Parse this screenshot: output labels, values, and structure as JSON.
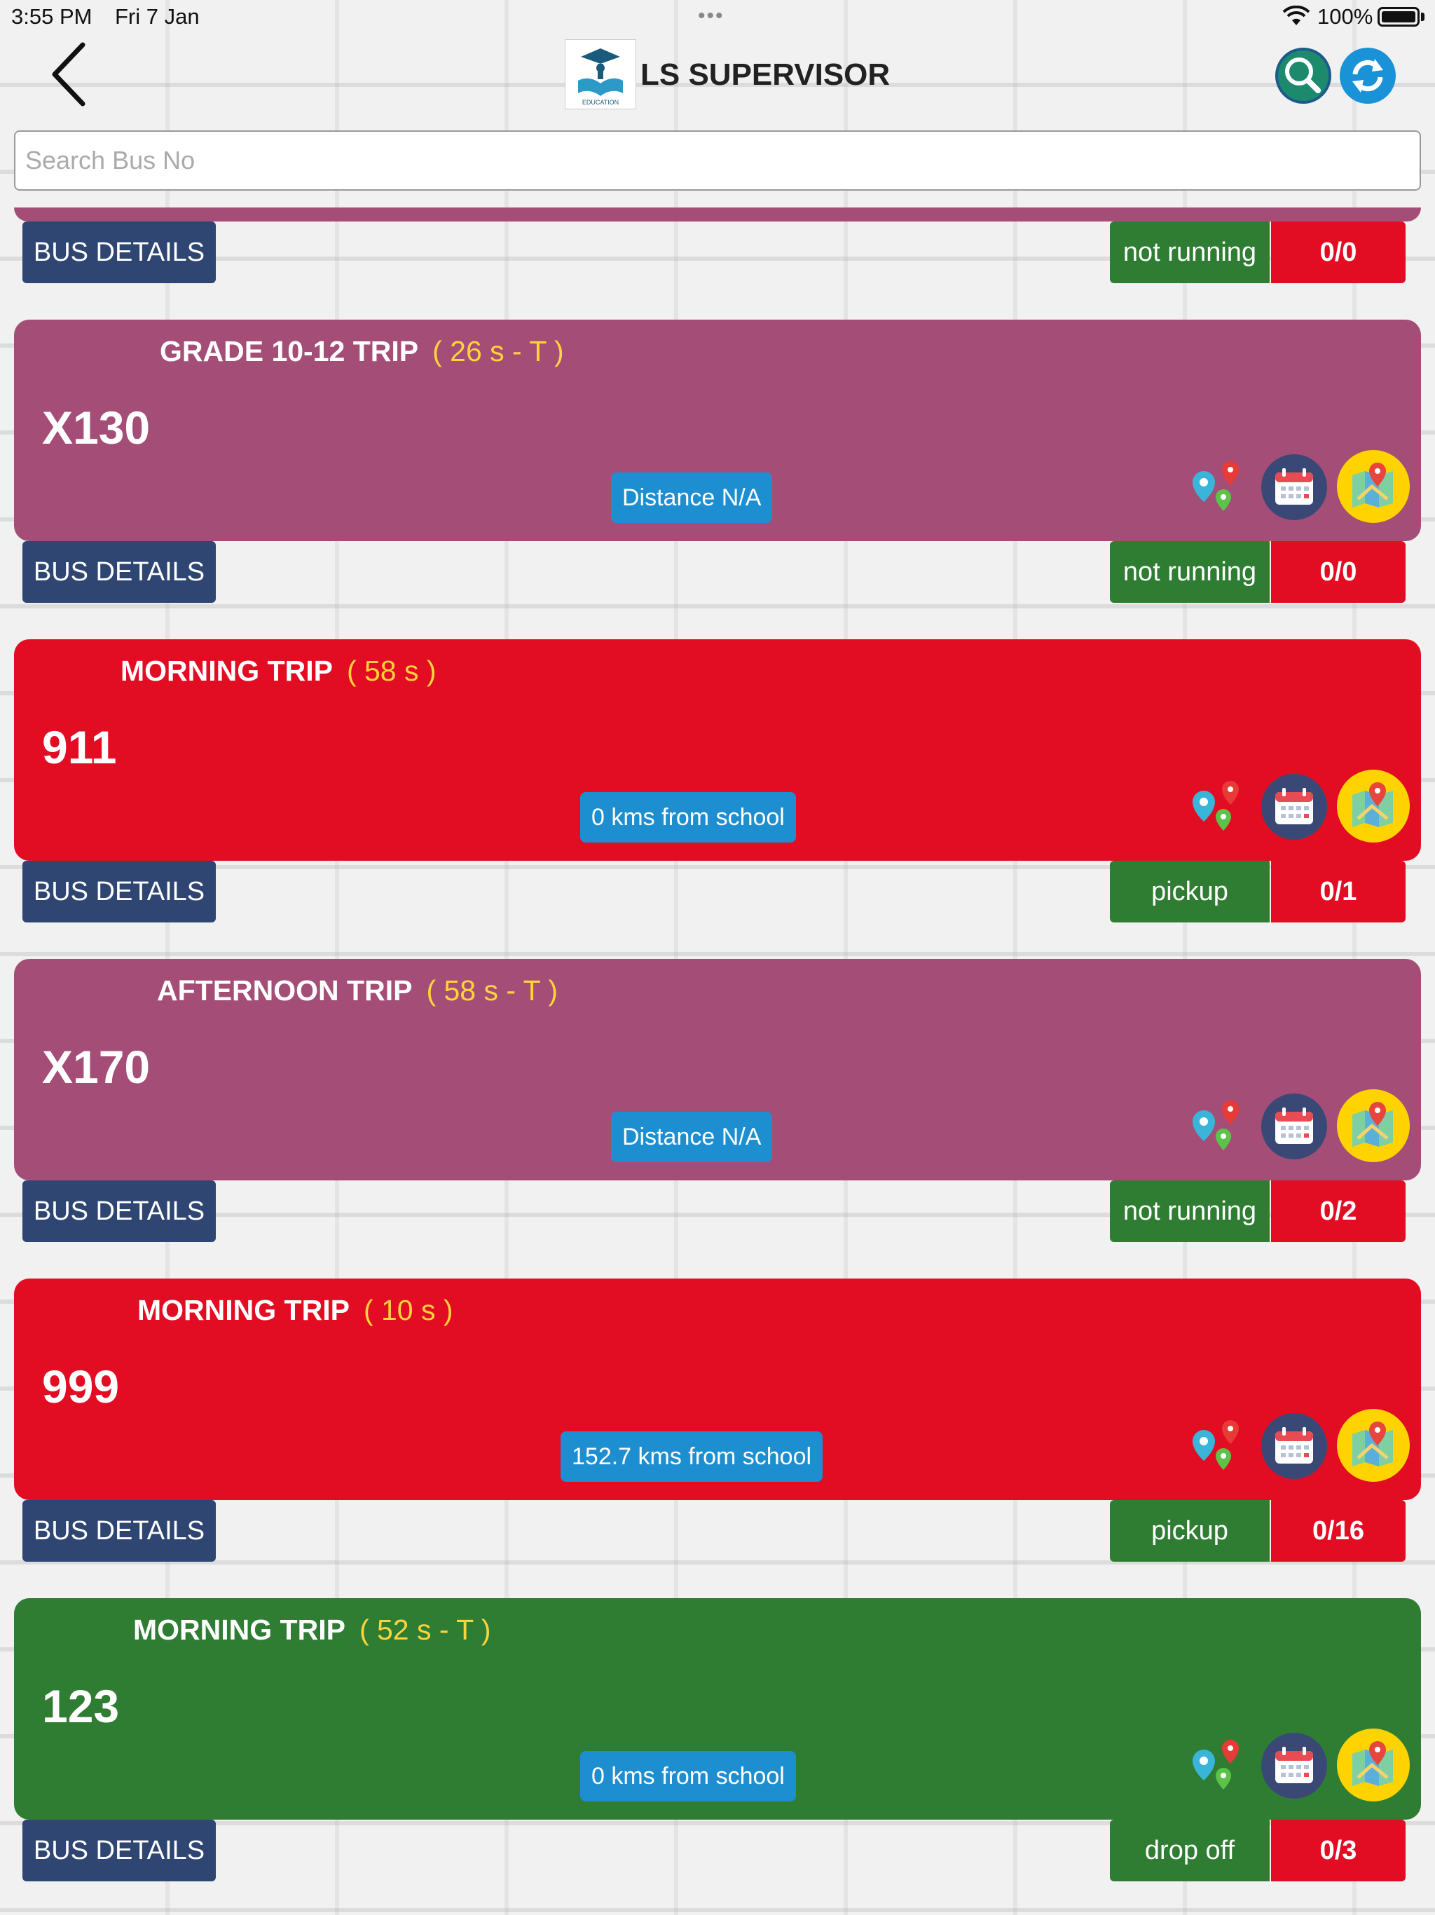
{
  "status_bar": {
    "time": "3:55 PM",
    "date": "Fri 7 Jan",
    "battery": "100%"
  },
  "header": {
    "title": "LS SUPERVISOR",
    "logo_text": "EDUCATION"
  },
  "search": {
    "placeholder": "Search Bus No"
  },
  "colors": {
    "purple": "#a44e77",
    "red": "#e20d23",
    "green": "#2f7d32",
    "navy": "#2e4671",
    "yellow": "#ffd33a",
    "blue": "#1d8fd1"
  },
  "partial_row": {
    "details_label": "BUS DETAILS",
    "status": "not running",
    "count": "0/0"
  },
  "cards": [
    {
      "title": "GRADE 10-12 TRIP",
      "subtitle": "( 26 s - T )",
      "bus_no": "X130",
      "distance": "Distance N/A",
      "details_label": "BUS DETAILS",
      "status": "not running",
      "count": "0/0",
      "color": "#a44e77"
    },
    {
      "title": "MORNING TRIP",
      "subtitle": "( 58 s )",
      "bus_no": "911",
      "distance": "0 kms from school",
      "details_label": "BUS DETAILS",
      "status": "pickup",
      "count": "0/1",
      "color": "#e20d23"
    },
    {
      "title": "AFTERNOON TRIP",
      "subtitle": "( 58 s - T )",
      "bus_no": "X170",
      "distance": "Distance N/A",
      "details_label": "BUS DETAILS",
      "status": "not running",
      "count": "0/2",
      "color": "#a44e77"
    },
    {
      "title": "MORNING TRIP",
      "subtitle": "( 10 s )",
      "bus_no": "999",
      "distance": "152.7 kms from school",
      "details_label": "BUS DETAILS",
      "status": "pickup",
      "count": "0/16",
      "color": "#e20d23"
    },
    {
      "title": "MORNING TRIP",
      "subtitle": "( 52 s - T )",
      "bus_no": "123",
      "distance": "0 kms from school",
      "details_label": "BUS DETAILS",
      "status": "drop off",
      "count": "0/3",
      "color": "#2f7d32"
    }
  ]
}
